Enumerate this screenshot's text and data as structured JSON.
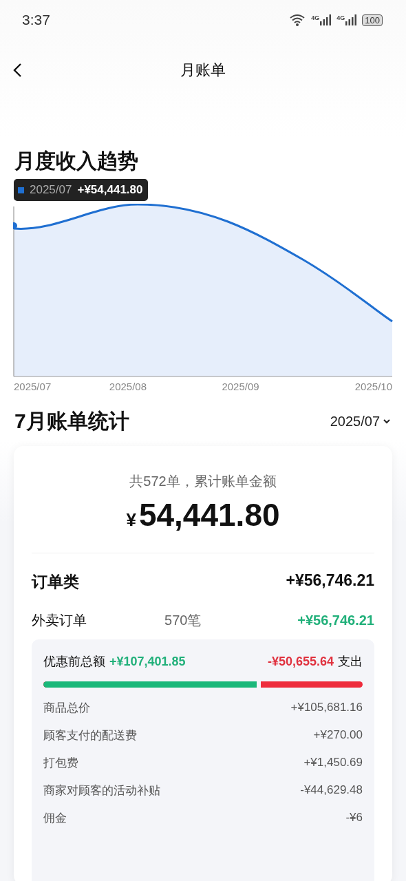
{
  "status_bar": {
    "time": "3:37",
    "networks": [
      "4G",
      "4G"
    ],
    "battery": "100"
  },
  "header": {
    "title": "月账单"
  },
  "trend": {
    "title": "月度收入趋势",
    "tooltip": {
      "date": "2025/07",
      "value": "+¥54,441.80"
    },
    "x_labels": [
      "2025/07",
      "2025/08",
      "2025/09",
      "2025/10"
    ]
  },
  "stats": {
    "title": "7月账单统计",
    "month_picker": "2025/07",
    "summary": "共572单，累计账单金额",
    "currency": "¥",
    "total": "54,441.80",
    "category": {
      "label": "订单类",
      "amount": "+¥56,746.21"
    },
    "subcategory": {
      "label": "外卖订单",
      "count": "570笔",
      "amount": "+¥56,746.21"
    },
    "breakdown": {
      "gross_label": "优惠前总额",
      "gross": "+¥107,401.85",
      "expense": "-¥50,655.64",
      "expense_label": "支出",
      "level": 0.68,
      "rows": [
        {
          "label": "商品总价",
          "amount": "+¥105,681.16"
        },
        {
          "label": "顾客支付的配送费",
          "amount": "+¥270.00"
        },
        {
          "label": "打包费",
          "amount": "+¥1,450.69"
        },
        {
          "label": "商家对顾客的活动补贴",
          "amount": "-¥44,629.48"
        },
        {
          "label": "佣金",
          "amount": "-¥6"
        }
      ]
    }
  }
}
